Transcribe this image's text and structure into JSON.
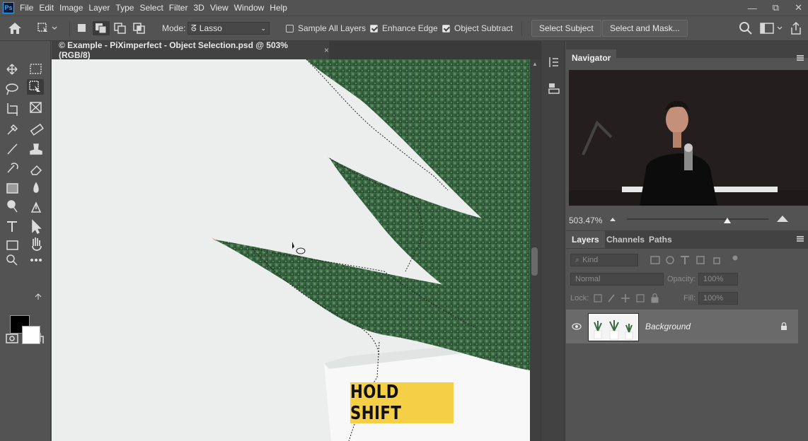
{
  "app": {
    "logo": "Ps"
  },
  "menu": [
    "File",
    "Edit",
    "Image",
    "Layer",
    "Type",
    "Select",
    "Filter",
    "3D",
    "View",
    "Window",
    "Help"
  ],
  "window_controls": {
    "minimize": "—",
    "restore": "⧉",
    "close": "✕"
  },
  "options": {
    "mode_label": "Mode:",
    "mode_value": "Lasso",
    "sample_all_layers": "Sample All Layers",
    "enhance_edge": "Enhance Edge",
    "object_subtract": "Object Subtract",
    "select_subject": "Select Subject",
    "select_and_mask": "Select and Mask..."
  },
  "document": {
    "tab_title": "© Example - PiXimperfect - Object Selection.psd @ 503% (RGB/8)",
    "close": "×",
    "overlay_text": "HOLD SHIFT"
  },
  "navigator": {
    "title": "Navigator",
    "zoom": "503.47%",
    "zoom_slider": 0.71
  },
  "layers_panel": {
    "tabs": [
      "Layers",
      "Channels",
      "Paths"
    ],
    "kind_placeholder": "Kind",
    "blend_mode": "Normal",
    "opacity_label": "Opacity:",
    "opacity_value": "100%",
    "lock_label": "Lock:",
    "fill_label": "Fill:",
    "fill_value": "100%",
    "layers": [
      {
        "name": "Background",
        "visible": true,
        "locked": true
      }
    ]
  },
  "colors": {
    "foreground": "#000000",
    "background": "#ffffff",
    "overlay": "#f5cf45"
  }
}
